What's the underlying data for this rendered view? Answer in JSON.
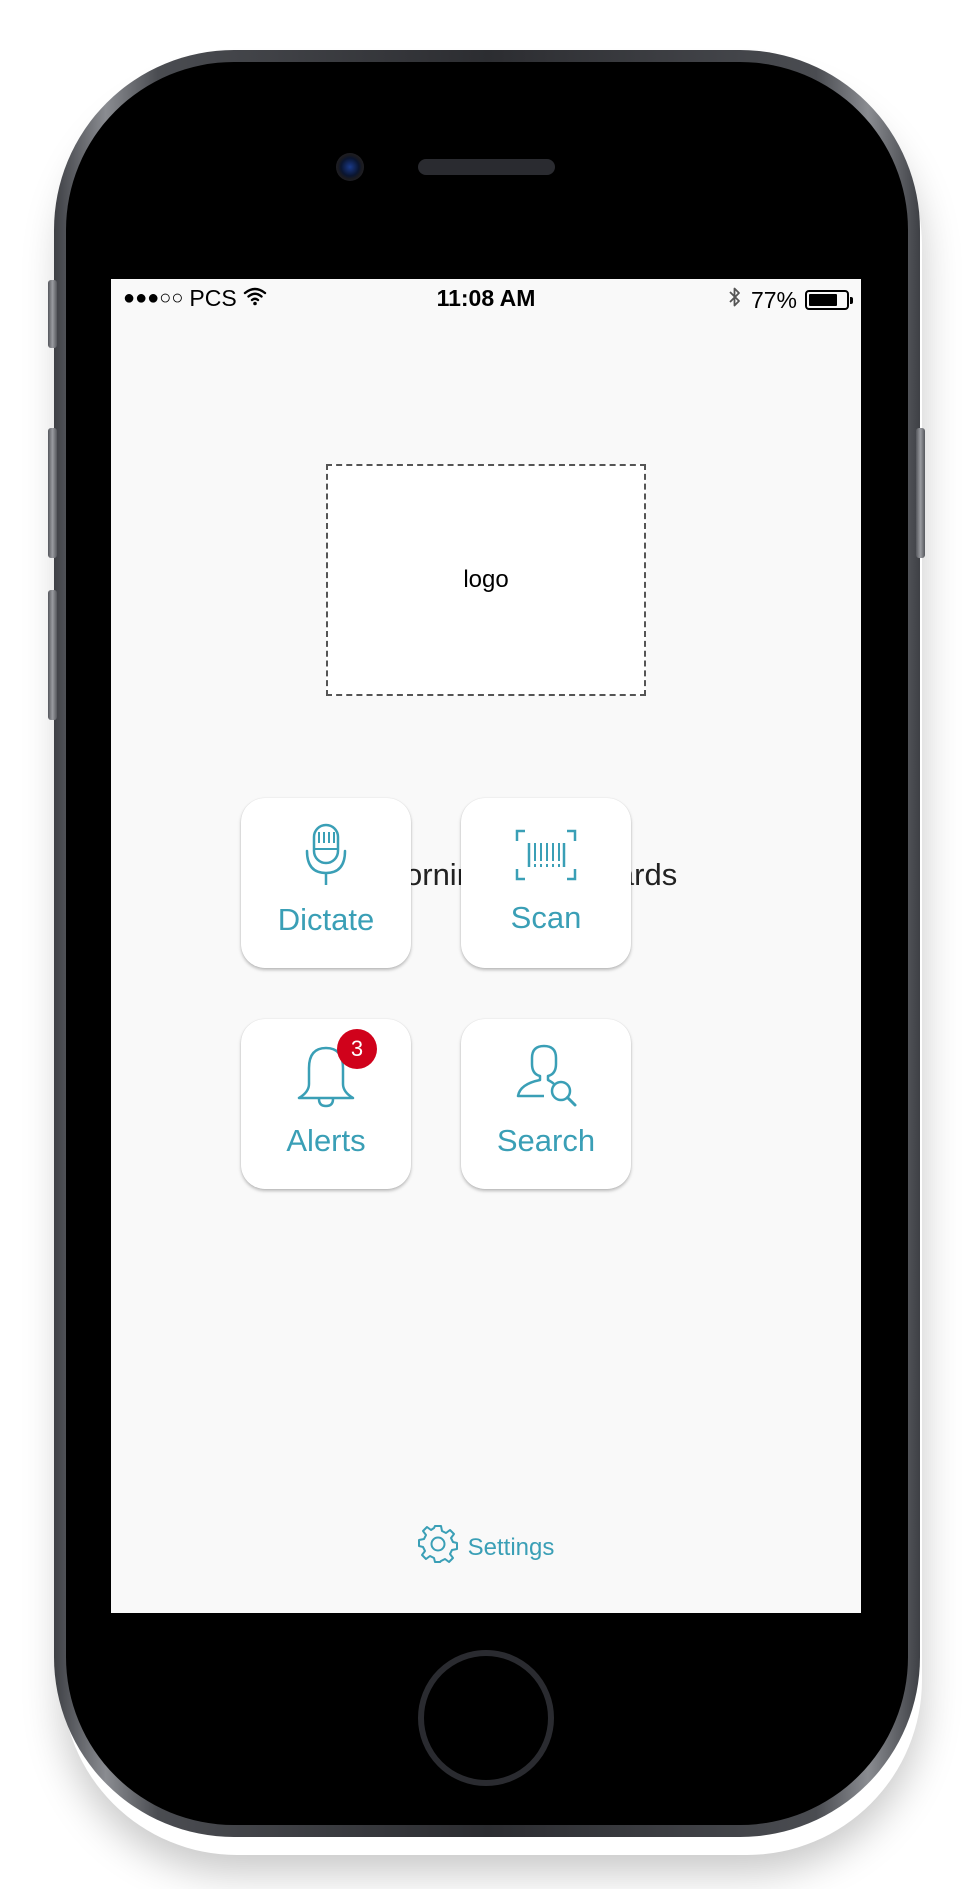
{
  "status_bar": {
    "signal": "●●●○○",
    "carrier": "PCS",
    "time": "11:08 AM",
    "battery_percent": "77%",
    "battery_level": 0.77
  },
  "logo": {
    "placeholder_text": "logo"
  },
  "greeting": "Good morning, Dr. Edwards",
  "actions": {
    "dictate_label": "Dictate",
    "scan_label": "Scan",
    "alerts_label": "Alerts",
    "alerts_badge": "3",
    "search_label": "Search"
  },
  "settings": {
    "label": "Settings"
  },
  "colors": {
    "accent": "#3a9fb6",
    "badge": "#d0021b",
    "screen_bg": "#f9f9f9"
  },
  "icons": {
    "dictate": "microphone-icon",
    "scan": "barcode-icon",
    "alerts": "bell-icon",
    "search": "person-search-icon",
    "settings": "gear-icon",
    "status": [
      "wifi-icon",
      "bluetooth-icon",
      "battery-icon"
    ]
  }
}
